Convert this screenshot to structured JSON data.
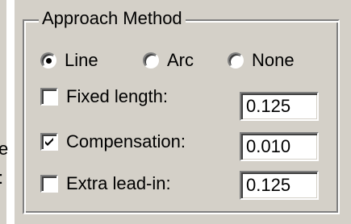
{
  "left_clipped_text": [
    "e",
    ":"
  ],
  "group": {
    "title": "Approach Method"
  },
  "approach": {
    "options": [
      {
        "label": "Line",
        "selected": true
      },
      {
        "label": "Arc",
        "selected": false
      },
      {
        "label": "None",
        "selected": false
      }
    ]
  },
  "settings": [
    {
      "label": "Fixed length:",
      "checked": false,
      "value": "0.125"
    },
    {
      "label": "Compensation:",
      "checked": true,
      "value": "0.010"
    },
    {
      "label": "Extra lead-in:",
      "checked": false,
      "value": "0.125"
    }
  ],
  "colors": {
    "face": "#d4d0c8",
    "shadow": "#808080",
    "highlight": "#ffffff",
    "dark_shadow": "#404040"
  }
}
